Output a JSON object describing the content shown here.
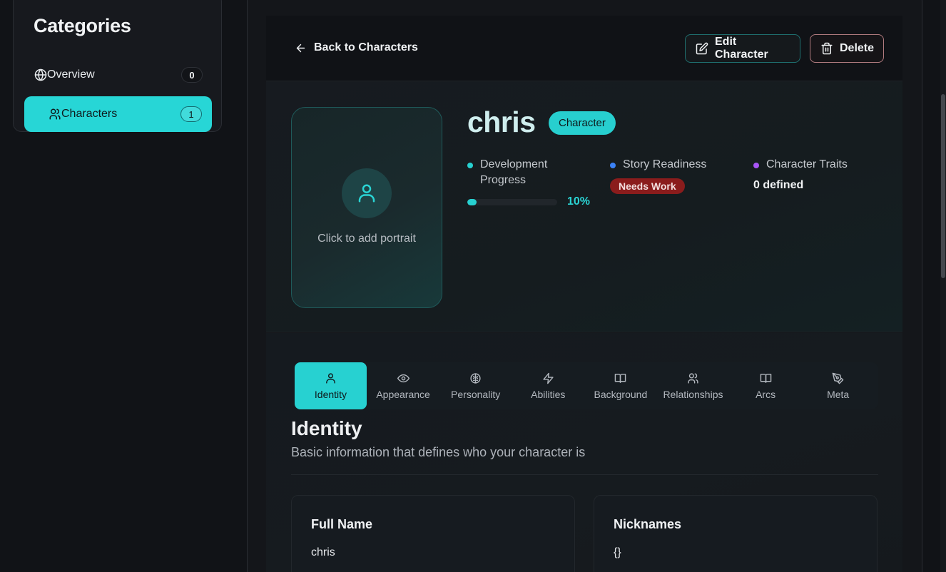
{
  "sidebar": {
    "title": "Categories",
    "items": [
      {
        "label": "Overview",
        "count": "0",
        "icon": "globe-icon"
      },
      {
        "label": "Characters",
        "count": "1",
        "icon": "users-icon"
      }
    ]
  },
  "topbar": {
    "back_label": "Back to Characters",
    "edit_label": "Edit Character",
    "delete_label": "Delete"
  },
  "character": {
    "name": "chris",
    "type_badge": "Character",
    "portrait_prompt": "Click to add portrait"
  },
  "stats": {
    "development": {
      "label": "Development Progress",
      "value": "10%",
      "progress": 0.1,
      "color": "#27d1d1"
    },
    "readiness": {
      "label": "Story Readiness",
      "status": "Needs Work",
      "color": "#3b82f6"
    },
    "traits": {
      "label": "Character Traits",
      "value": "0 defined",
      "color": "#a855f7"
    }
  },
  "tabs": [
    {
      "label": "Identity",
      "icon": "user-icon",
      "active": true
    },
    {
      "label": "Appearance",
      "icon": "eye-icon"
    },
    {
      "label": "Personality",
      "icon": "brain-icon"
    },
    {
      "label": "Abilities",
      "icon": "bolt-icon"
    },
    {
      "label": "Background",
      "icon": "book-icon"
    },
    {
      "label": "Relationships",
      "icon": "users-icon"
    },
    {
      "label": "Arcs",
      "icon": "book-open-icon"
    },
    {
      "label": "Meta",
      "icon": "pen-icon"
    }
  ],
  "section": {
    "title": "Identity",
    "description": "Basic information that defines who your character is"
  },
  "fields": [
    {
      "label": "Full Name",
      "value": "chris"
    },
    {
      "label": "Nicknames",
      "value": "{}"
    }
  ],
  "colors": {
    "accent": "#27d1d1",
    "danger": "#8a1c1c",
    "background": "#111317"
  }
}
